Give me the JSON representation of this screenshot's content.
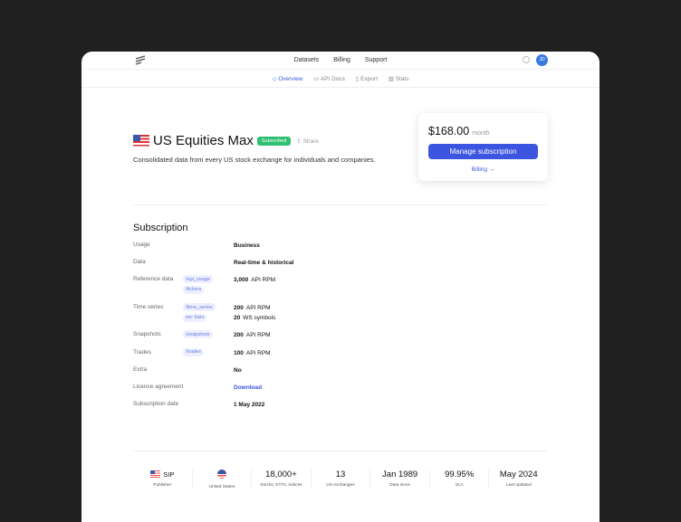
{
  "nav": {
    "items": [
      "Datasets",
      "Billing",
      "Support"
    ],
    "avatar": "JD"
  },
  "subnav": [
    "Overview",
    "API Docs",
    "Export",
    "Stats"
  ],
  "hero": {
    "title": "US Equities Max",
    "badge": "Subscribed",
    "share": "Share",
    "description": "Consolidated data from every US stock exchange for individuals and companies."
  },
  "price": {
    "amount": "$168.00",
    "period": "month",
    "button": "Manage subscription",
    "billing": "Billing →"
  },
  "subscription": {
    "heading": "Subscription",
    "rows": [
      {
        "label": "Usage",
        "tags": [],
        "values": [
          "Business"
        ]
      },
      {
        "label": "Data",
        "tags": [],
        "values": [
          "Real-time & historical"
        ]
      },
      {
        "label": "Reference data",
        "tags": [
          "/api_usage",
          "/tickers"
        ],
        "values": [
          [
            "3,000",
            "API RPM"
          ]
        ]
      },
      {
        "label": "Time series",
        "tags": [
          "/time_series",
          "ws: bars"
        ],
        "values": [
          [
            "200",
            "API RPM"
          ],
          [
            "20",
            "WS symbols"
          ]
        ]
      },
      {
        "label": "Snapshots",
        "tags": [
          "/snapshots"
        ],
        "values": [
          [
            "200",
            "API RPM"
          ]
        ]
      },
      {
        "label": "Trades",
        "tags": [
          "/trades"
        ],
        "values": [
          [
            "100",
            "API RPM"
          ]
        ]
      },
      {
        "label": "Extra",
        "tags": [],
        "values": [
          "No"
        ]
      },
      {
        "label": "Licence agreement",
        "tags": [],
        "link": "Download"
      },
      {
        "label": "Subscription date",
        "tags": [],
        "values": [
          "1 May 2022"
        ]
      }
    ]
  },
  "stats": [
    {
      "value": "SIP",
      "label": "Publisher"
    },
    {
      "value": "",
      "label": "United States"
    },
    {
      "value": "18,000+",
      "label": "Stocks, ETFs, Indices"
    },
    {
      "value": "13",
      "label": "US exchanges"
    },
    {
      "value": "Jan 1989",
      "label": "Data since"
    },
    {
      "value": "99.95%",
      "label": "SLA"
    },
    {
      "value": "May 2024",
      "label": "Last updated"
    }
  ]
}
